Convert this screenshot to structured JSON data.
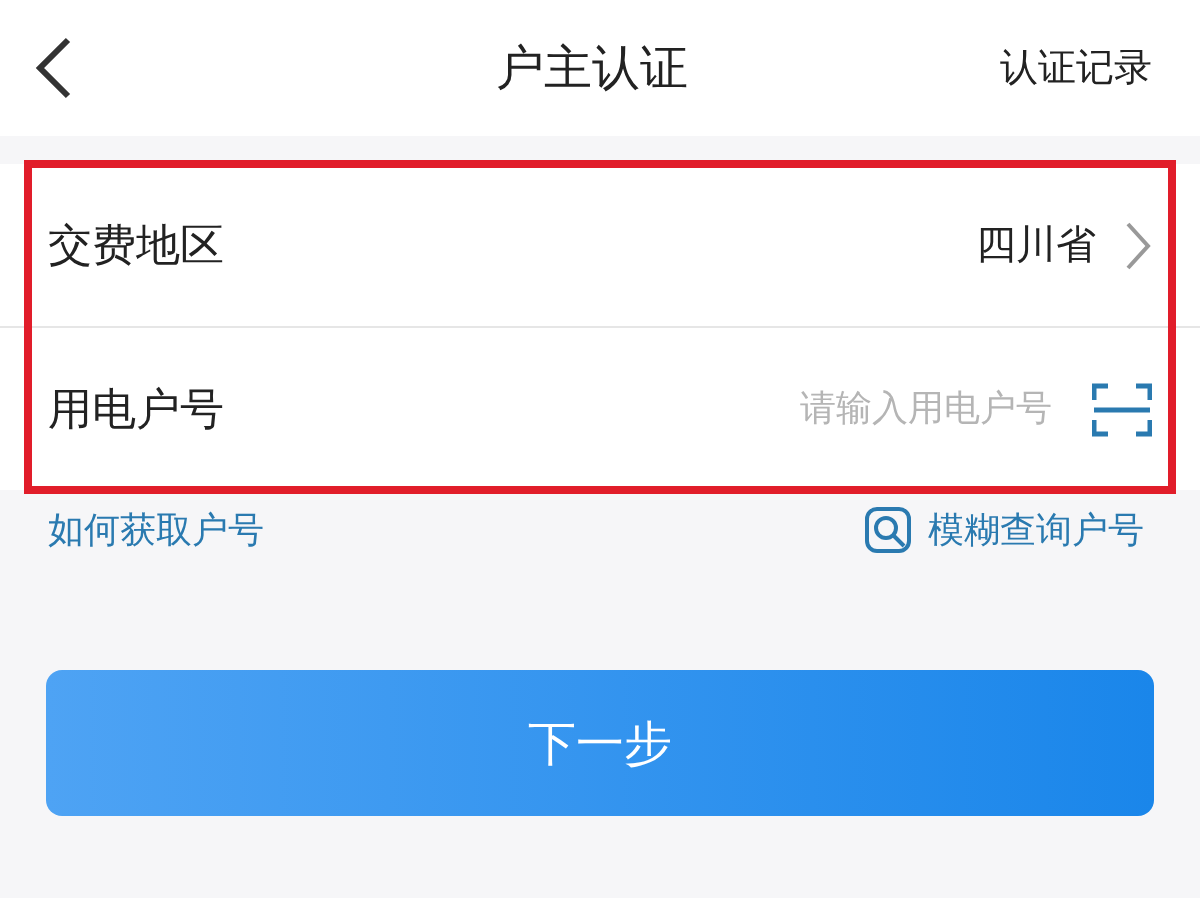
{
  "header": {
    "title": "户主认证",
    "action": "认证记录"
  },
  "form": [
    {
      "kind": "select",
      "label": "交费地区",
      "value": "四川省"
    },
    {
      "kind": "input",
      "label": "用电户号",
      "placeholder": "请输入用电户号"
    }
  ],
  "links": {
    "help": "如何获取户号",
    "search": "模糊查询户号"
  },
  "button": {
    "label": "下一步"
  }
}
